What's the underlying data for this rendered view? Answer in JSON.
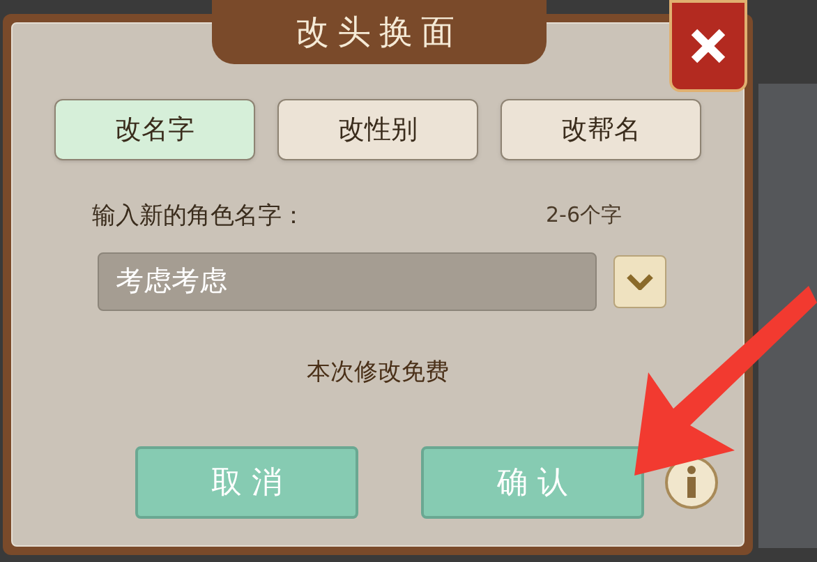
{
  "dialog": {
    "title": "改头换面",
    "tabs": [
      {
        "label": "改名字",
        "selected": true
      },
      {
        "label": "改性别",
        "selected": false
      },
      {
        "label": "改帮名",
        "selected": false
      }
    ],
    "name_label": "输入新的角色名字：",
    "length_hint": "2-6个字",
    "name_field": {
      "value": "考虑考虑"
    },
    "cost_note": "本次修改免费",
    "buttons": [
      "取 消",
      "确 认"
    ]
  }
}
